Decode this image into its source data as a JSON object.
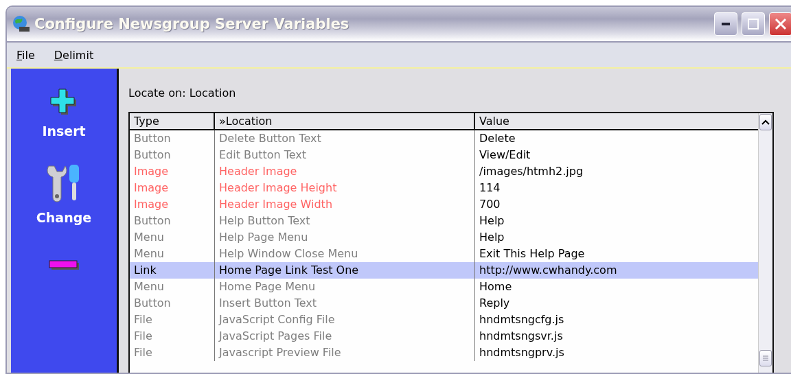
{
  "window": {
    "title": "Configure Newsgroup Server Variables"
  },
  "menu": [
    {
      "label": "File"
    },
    {
      "label": "Delimit"
    }
  ],
  "sidebar": [
    {
      "kind": "insert",
      "label": "Insert"
    },
    {
      "kind": "change",
      "label": "Change"
    },
    {
      "kind": "delete"
    }
  ],
  "locate_label": "Locate on: Location",
  "table": {
    "columns": [
      "Type",
      "»Location",
      "Value"
    ],
    "rows": [
      {
        "type": "Button",
        "location": "Delete Button Text",
        "value": "Delete",
        "color": "#808080",
        "selected": false
      },
      {
        "type": "Button",
        "location": "Edit Button Text",
        "value": "View/Edit",
        "color": "#808080",
        "selected": false
      },
      {
        "type": "Image",
        "location": "Header Image",
        "value": "/images/htmh2.jpg",
        "color": "#ff6464",
        "selected": false
      },
      {
        "type": "Image",
        "location": "Header Image Height",
        "value": "114",
        "color": "#ff6464",
        "selected": false
      },
      {
        "type": "Image",
        "location": "Header Image Width",
        "value": "700",
        "color": "#ff6464",
        "selected": false
      },
      {
        "type": "Button",
        "location": "Help Button Text",
        "value": "Help",
        "color": "#808080",
        "selected": false
      },
      {
        "type": "Menu",
        "location": "Help Page Menu",
        "value": "Help",
        "color": "#808080",
        "selected": false
      },
      {
        "type": "Menu",
        "location": "Help Window Close Menu",
        "value": "Exit This Help Page",
        "color": "#808080",
        "selected": false
      },
      {
        "type": "Link",
        "location": "Home Page Link Test One",
        "value": "http://www.cwhandy.com",
        "selected": true
      },
      {
        "type": "Menu",
        "location": "Home Page Menu",
        "value": "Home",
        "color": "#808080",
        "selected": false
      },
      {
        "type": "Button",
        "location": "Insert Button Text",
        "value": "Reply",
        "color": "#808080",
        "selected": false
      },
      {
        "type": "File",
        "location": "JavaScript Config File",
        "value": "hndmtsngcfg.js",
        "color": "#808080",
        "selected": false
      },
      {
        "type": "File",
        "location": "JavaScript Pages File",
        "value": "hndmtsngsvr.js",
        "color": "#808080",
        "selected": false
      },
      {
        "type": "File",
        "location": "Javascript Preview File",
        "value": "hndmtsngprv.js",
        "color": "#808080",
        "selected": false
      }
    ]
  }
}
